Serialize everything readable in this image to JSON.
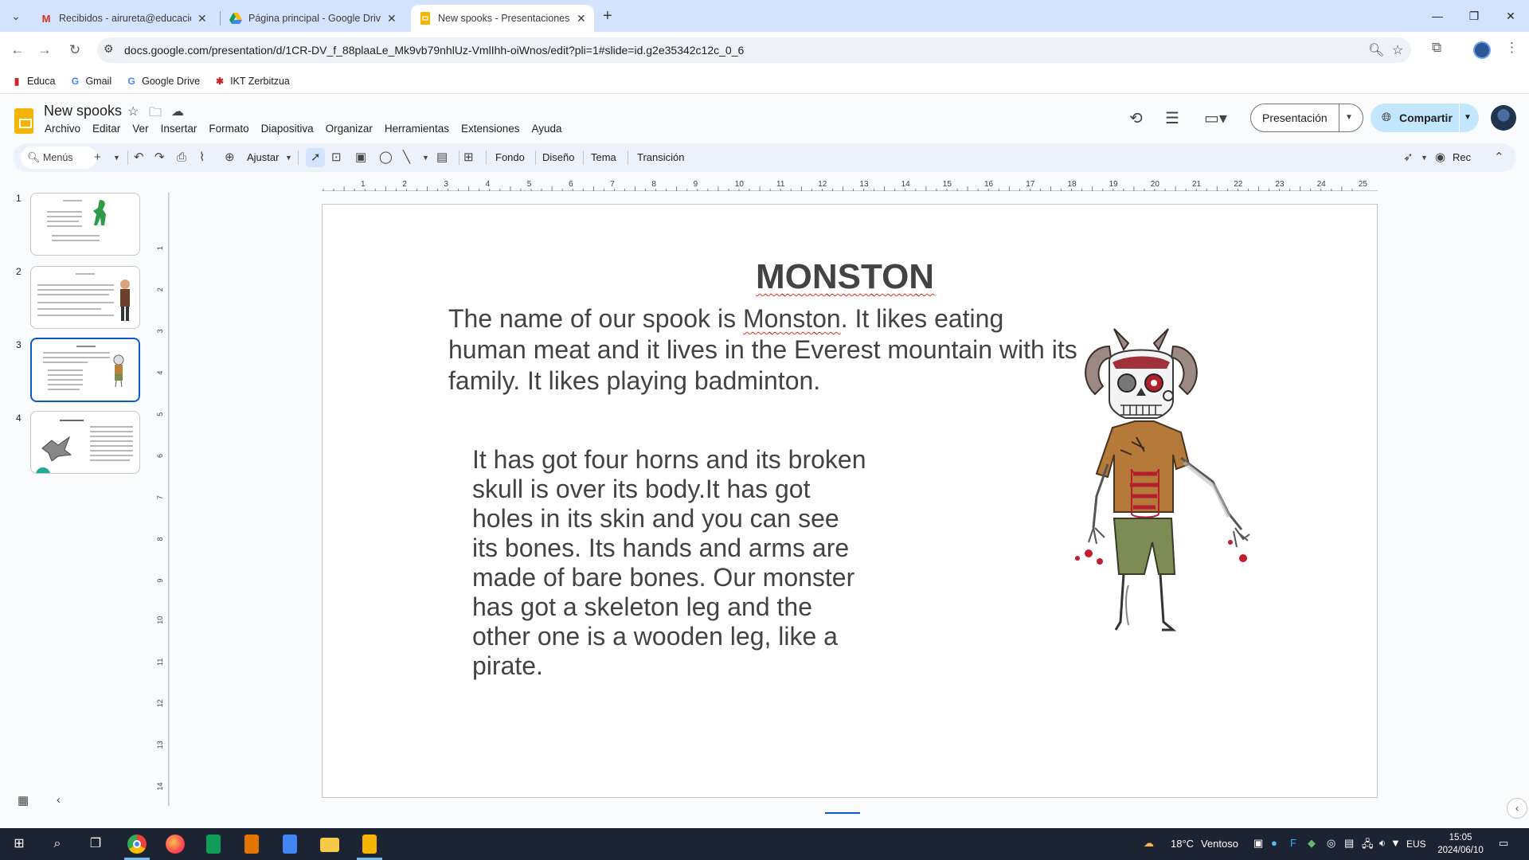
{
  "browser": {
    "tabs": [
      {
        "title": "Recibidos - airureta@educacion",
        "icon": "gmail-icon"
      },
      {
        "title": "Página principal - Google Drive",
        "icon": "google-drive-icon"
      },
      {
        "title": "New spooks - Presentaciones de",
        "icon": "google-slides-icon",
        "active": true
      }
    ],
    "url": "docs.google.com/presentation/d/1CR-DV_f_88plaaLe_Mk9vb79nhlUz-VmlIhh-oiWnos/edit?pli=1#slide=id.g2e35342c12c_0_6",
    "bookmarks": [
      {
        "label": "Educa",
        "icon": "educa-icon"
      },
      {
        "label": "Gmail",
        "icon": "google-icon"
      },
      {
        "label": "Google Drive",
        "icon": "google-icon"
      },
      {
        "label": "IKT Zerbitzua",
        "icon": "ikt-icon"
      }
    ]
  },
  "app": {
    "doc_title": "New spooks",
    "menu": [
      "Archivo",
      "Editar",
      "Ver",
      "Insertar",
      "Formato",
      "Diapositiva",
      "Organizar",
      "Herramientas",
      "Extensiones",
      "Ayuda"
    ],
    "present_label": "Presentación",
    "share_label": "Compartir"
  },
  "toolbar": {
    "menus_label": "Menús",
    "zoom_label": "Ajustar",
    "fondo": "Fondo",
    "diseno": "Diseño",
    "tema": "Tema",
    "transicion": "Transición",
    "rec": "Rec"
  },
  "slides_panel": {
    "numbers": [
      "1",
      "2",
      "3",
      "4"
    ],
    "selected": 3
  },
  "ruler": {
    "top": [
      "1",
      "2",
      "3",
      "4",
      "5",
      "6",
      "7",
      "8",
      "9",
      "10",
      "11",
      "12",
      "13",
      "14",
      "15",
      "16",
      "17",
      "18",
      "19",
      "20",
      "21",
      "22",
      "23",
      "24",
      "25"
    ],
    "left": [
      "1",
      "2",
      "3",
      "4",
      "5",
      "6",
      "7",
      "8",
      "9",
      "10",
      "11",
      "12",
      "13",
      "14"
    ]
  },
  "slide": {
    "title": "MONSTON",
    "para1_a": "The name of our spook is ",
    "para1_b": "Monston",
    "para1_c": ".  It likes eating human meat and it lives in the Everest mountain with its family. It likes playing badminton.",
    "para2": "It has got four horns and its broken skull is over its body.It has got holes in its skin and you can see its bones. Its hands and arms are made of bare bones. Our monster has got a skeleton leg and the other one is a wooden leg, like a pirate."
  },
  "taskbar": {
    "temperature": "18°C",
    "weather": "Ventoso",
    "lang": "EUS",
    "time": "15:05",
    "date": "2024/06/10"
  }
}
